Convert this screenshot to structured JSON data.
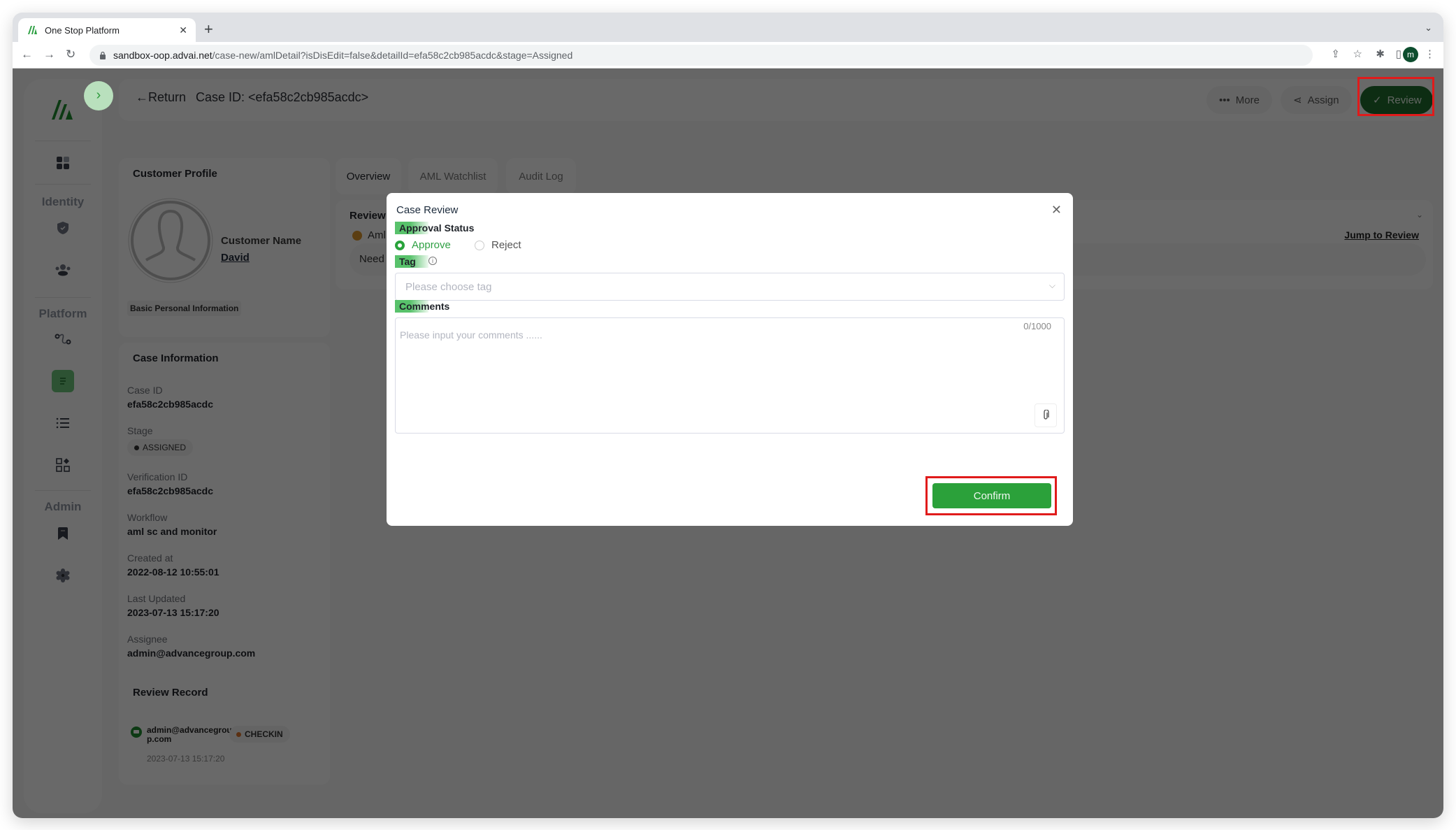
{
  "browser": {
    "tab_title": "One Stop Platform",
    "url_host": "sandbox-oop.advai.net",
    "url_path": "/case-new/amlDetail?isDisEdit=false&detailId=efa58c2cb985acdc&stage=Assigned",
    "profile_initial": "m"
  },
  "sidebar": {
    "sections": [
      "Identity",
      "Platform",
      "Admin"
    ],
    "items": [
      {
        "icon": "dashboard-icon"
      },
      {
        "icon": "shield-check-icon",
        "section": "Identity"
      },
      {
        "icon": "users-icon",
        "section": "Identity"
      },
      {
        "icon": "workflow-icon",
        "section": "Platform"
      },
      {
        "icon": "case-document-icon",
        "section": "Platform",
        "active": true
      },
      {
        "icon": "list-icon",
        "section": "Platform"
      },
      {
        "icon": "apps-icon",
        "section": "Platform"
      },
      {
        "icon": "bookmark-icon",
        "section": "Admin"
      },
      {
        "icon": "settings-icon",
        "section": "Admin"
      }
    ]
  },
  "header": {
    "return_label": "←Return",
    "case_title": "Case ID: <efa58c2cb985acdc>",
    "more_label": "More",
    "assign_label": "Assign",
    "review_label": "Review"
  },
  "customer_profile": {
    "title": "Customer Profile",
    "name_label": "Customer Name",
    "name_value": "David",
    "basic_info_label": "Basic Personal Information"
  },
  "case_information": {
    "title": "Case Information",
    "fields": [
      {
        "label": "Case ID",
        "value": "efa58c2cb985acdc"
      },
      {
        "label": "Stage",
        "value": "ASSIGNED"
      },
      {
        "label": "Verification ID",
        "value": "efa58c2cb985acdc"
      },
      {
        "label": "Workflow",
        "value": "aml sc and monitor"
      },
      {
        "label": "Created at",
        "value": "2022-08-12 10:55:01"
      },
      {
        "label": "Last Updated",
        "value": "2023-07-13 15:17:20"
      },
      {
        "label": "Assignee",
        "value": "admin@advancegroup.com"
      }
    ]
  },
  "review_record": {
    "title": "Review Record",
    "entries": [
      {
        "user_line1": "admin@advancegrou",
        "user_line2": "p.com",
        "status": "CHECKIN",
        "time": "2023-07-13 15:17:20"
      }
    ]
  },
  "main_tabs": [
    {
      "label": "Overview",
      "active": true
    },
    {
      "label": "AML Watchlist"
    },
    {
      "label": "Audit Log"
    }
  ],
  "review_summary": {
    "title_partial": "Review S",
    "item_partial": "Aml",
    "need_partial": "Need",
    "jump_link": "Jump to Review"
  },
  "modal": {
    "title": "Case Review",
    "approval_label": "Approval Status",
    "options": [
      {
        "label": "Approve",
        "selected": true
      },
      {
        "label": "Reject",
        "selected": false
      }
    ],
    "tag_label": "Tag",
    "tag_placeholder": "Please choose tag",
    "comments_label": "Comments",
    "comments_placeholder": "Please input your comments ......",
    "comments_count": "0/1000",
    "confirm_label": "Confirm"
  },
  "colors": {
    "brand_green": "#2ba13a",
    "review_button": "#1f6b2e",
    "highlight_box": "#e01b1b",
    "checkin_dot": "#d9742b"
  }
}
